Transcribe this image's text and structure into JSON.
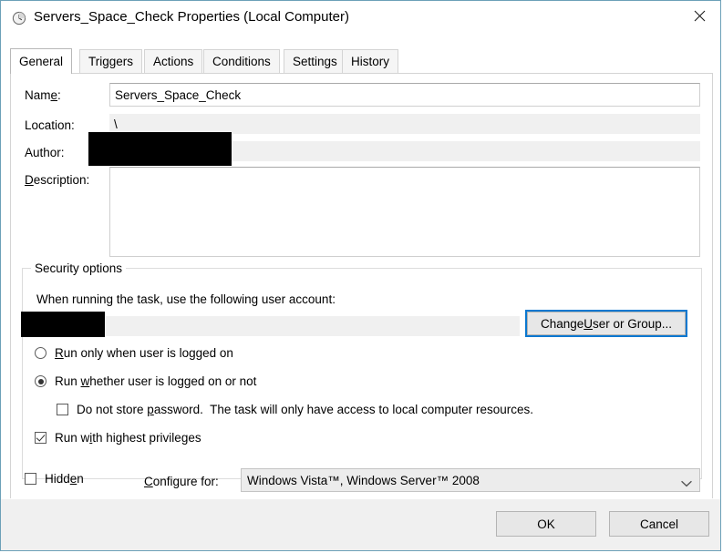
{
  "window": {
    "title": "Servers_Space_Check Properties (Local Computer)",
    "icon": "clock-schedule-icon",
    "close_label": "✕",
    "border_color": "#6ca0b8"
  },
  "tabs": [
    {
      "label": "General",
      "active": true
    },
    {
      "label": "Triggers",
      "active": false
    },
    {
      "label": "Actions",
      "active": false
    },
    {
      "label": "Conditions",
      "active": false
    },
    {
      "label": "Settings",
      "active": false
    },
    {
      "label": "History",
      "active": false
    }
  ],
  "general": {
    "name_label": "Name:",
    "name_value": "Servers_Space_Check",
    "location_label": "Location:",
    "location_value": "\\",
    "author_label": "Author:",
    "author_value": "",
    "description_label": "Description:",
    "description_value": "",
    "description_placeholder": ""
  },
  "security": {
    "group_label": "Security options",
    "account_prompt": "When running the task, use the following user account:",
    "account_value": "",
    "change_button_label": "Change User or Group...",
    "change_button_focused": true,
    "run_only_logged_on": {
      "label": "Run only when user is logged on",
      "selected": false
    },
    "run_whether_logged_on": {
      "label": "Run whether user is logged on or not",
      "selected": true
    },
    "do_not_store_password": {
      "label": "Do not store password.  The task will only have access to local computer resources.",
      "checked": false
    },
    "run_highest_privileges": {
      "label": "Run with highest privileges",
      "checked": true
    }
  },
  "footer_options": {
    "hidden_label": "Hidden",
    "hidden_checked": false,
    "configure_for_label": "Configure for:",
    "configure_for_value": "Windows Vista™, Windows Server™ 2008"
  },
  "buttons": {
    "ok_label": "OK",
    "cancel_label": "Cancel"
  },
  "colors": {
    "accent_focus": "#0a78d0",
    "window_border": "#6ca0b8",
    "readonly_field": "#f0f0f0"
  }
}
